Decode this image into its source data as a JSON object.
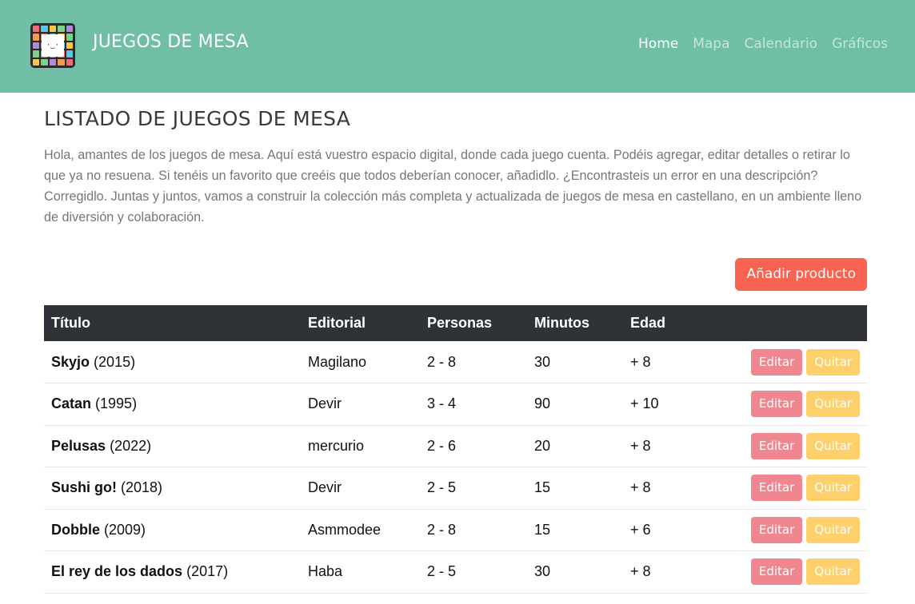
{
  "nav": {
    "brand": "JUEGOS DE MESA",
    "links": [
      {
        "label": "Home",
        "active": true
      },
      {
        "label": "Mapa",
        "active": false
      },
      {
        "label": "Calendario",
        "active": false
      },
      {
        "label": "Gráficos",
        "active": false
      }
    ]
  },
  "main": {
    "title": "LISTADO DE JUEGOS DE MESA",
    "intro": "Hola, amantes de los juegos de mesa. Aquí está vuestro espacio digital, donde cada juego cuenta. Podéis agregar, editar detalles o retirar lo que ya no resuena. Si tenéis un favorito que creéis que todos deberían conocer, añadidlo. ¿Encontrasteis un error en una descripción? Corregidlo. Juntas y juntos, vamos a construir la colección más completa y actualizada de juegos de mesa en castellano, en un ambiente lleno de diversión y colaboración.",
    "add_button": "Añadir producto"
  },
  "table": {
    "headers": [
      "Título",
      "Editorial",
      "Personas",
      "Minutos",
      "Edad"
    ],
    "edit_label": "Editar",
    "remove_label": "Quitar",
    "rows": [
      {
        "name": "Skyjo",
        "year": "(2015)",
        "editorial": "Magilano",
        "players": "2 - 8",
        "minutes": "30",
        "age": "+ 8"
      },
      {
        "name": "Catan",
        "year": "(1995)",
        "editorial": "Devir",
        "players": "3 - 4",
        "minutes": "90",
        "age": "+ 10"
      },
      {
        "name": "Pelusas",
        "year": "(2022)",
        "editorial": "mercurio",
        "players": "2 - 6",
        "minutes": "20",
        "age": "+ 8"
      },
      {
        "name": "Sushi go!",
        "year": "(2018)",
        "editorial": "Devir",
        "players": "2 - 5",
        "minutes": "15",
        "age": "+ 8"
      },
      {
        "name": "Dobble",
        "year": "(2009)",
        "editorial": "Asmmodee",
        "players": "2 - 8",
        "minutes": "15",
        "age": "+ 6"
      },
      {
        "name": "El rey de los dados",
        "year": "(2017)",
        "editorial": "Haba",
        "players": "2 - 5",
        "minutes": "30",
        "age": "+ 8"
      }
    ]
  },
  "colors": {
    "navbar": "#6fbea5",
    "add_button": "#f96352",
    "edit_button": "#f0868f",
    "remove_button": "#fdd06b",
    "table_header": "#2f3237"
  }
}
